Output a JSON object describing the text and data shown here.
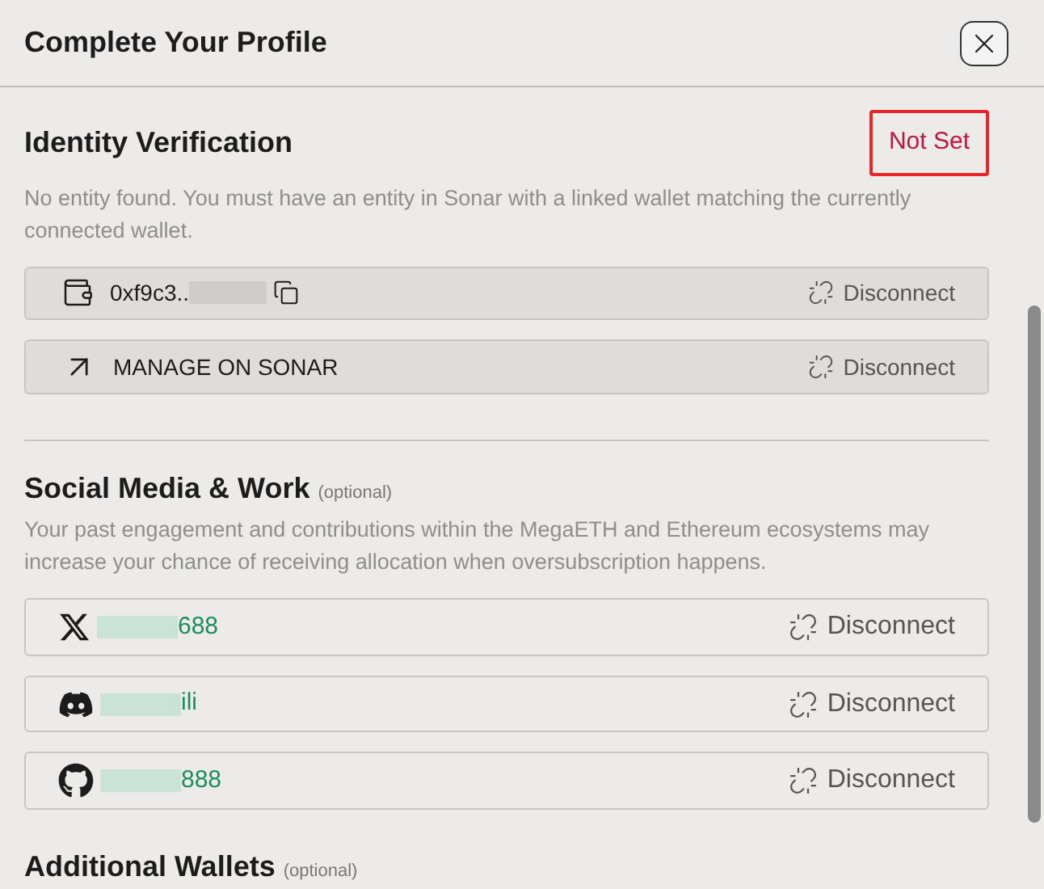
{
  "dialog": {
    "title": "Complete Your Profile"
  },
  "identity": {
    "title": "Identity Verification",
    "status": "Not Set",
    "status_highlighted": true,
    "description": "No entity found. You must have an entity in Sonar with a linked wallet matching the currently connected wallet.",
    "rows": [
      {
        "kind": "wallet",
        "label": "0xf9c3..",
        "redacted": true,
        "action": "Disconnect"
      },
      {
        "kind": "manage",
        "label": "MANAGE ON SONAR",
        "redacted": false,
        "action": "Disconnect"
      }
    ]
  },
  "social": {
    "title": "Social Media & Work",
    "optional": "(optional)",
    "description": "Your past engagement and contributions within the MegaETH and Ethereum ecosystems may increase your chance of receiving allocation when oversubscription happens.",
    "accounts": [
      {
        "kind": "x",
        "handle": "688",
        "action": "Disconnect"
      },
      {
        "kind": "discord",
        "handle": "ili",
        "action": "Disconnect"
      },
      {
        "kind": "github",
        "handle": "888",
        "action": "Disconnect"
      }
    ]
  },
  "wallets": {
    "title": "Additional Wallets",
    "optional": "(optional)"
  }
}
